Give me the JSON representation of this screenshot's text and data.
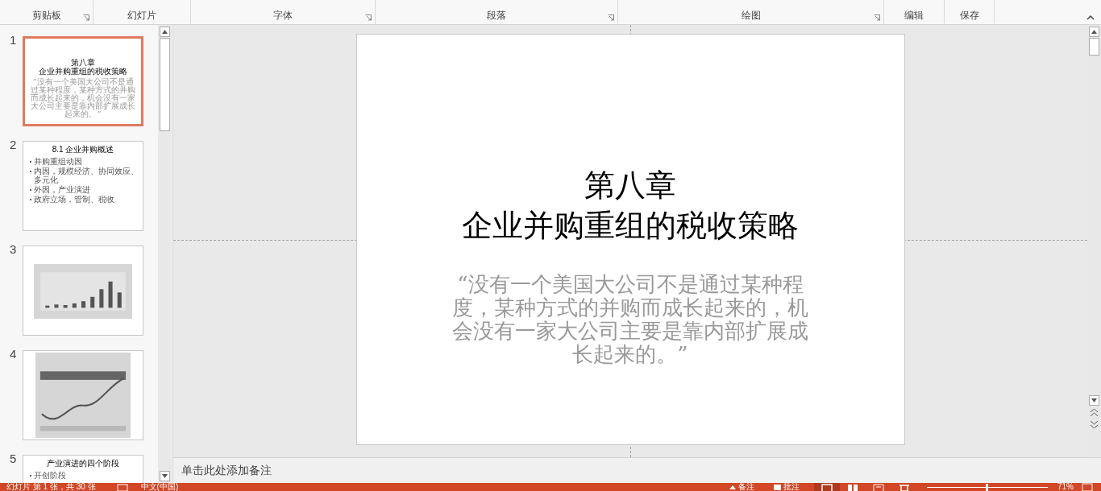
{
  "ribbon": {
    "groups": [
      {
        "label": "剪贴板",
        "launcher": true
      },
      {
        "label": "幻灯片",
        "launcher": false
      },
      {
        "label": "字体",
        "launcher": true
      },
      {
        "label": "段落",
        "launcher": true
      },
      {
        "label": "绘图",
        "launcher": true
      },
      {
        "label": "编辑",
        "launcher": false
      },
      {
        "label": "保存",
        "launcher": false
      }
    ]
  },
  "slides": [
    {
      "number": "1",
      "selected": true,
      "kind": "title",
      "title": [
        "第八章",
        "企业并购重组的税收策略"
      ],
      "quote": "“没有一个美国大公司不是通过某种程度，某种方式的并购而成长起来的，机会没有一家大公司主要是靠内部扩展成长起来的。”"
    },
    {
      "number": "2",
      "selected": false,
      "kind": "bullets",
      "title": "8.1 企业并购概述",
      "bullets": [
        "并购重组动因",
        "内因，规模经济、协同效应、多元化",
        "外因，产业演进",
        "政府立场，管制、税收"
      ]
    },
    {
      "number": "3",
      "selected": false,
      "kind": "picture"
    },
    {
      "number": "4",
      "selected": false,
      "kind": "picture"
    },
    {
      "number": "5",
      "selected": false,
      "kind": "bullets",
      "title": "产业演进的四个阶段",
      "bullets": [
        "开创阶段"
      ]
    }
  ],
  "editor": {
    "title": [
      "第八章",
      "企业并购重组的税收策略"
    ],
    "quote": "“没有一个美国大公司不是通过某种程度，某种方式的并购而成长起来的，机会没有一家大公司主要是靠内部扩展成长起来的。”"
  },
  "notes": {
    "placeholder": "单击此处添加备注"
  },
  "status_bar": {
    "slide_info": "幻灯片 第 1 张，共 30 张",
    "language": "中文(中国)",
    "notes_button": "备注",
    "comments_button": "批注",
    "views": [
      {
        "kind": "normal",
        "selected": true
      },
      {
        "kind": "sorter",
        "selected": false
      },
      {
        "kind": "reading",
        "selected": false
      },
      {
        "kind": "show",
        "selected": false
      }
    ],
    "zoom": {
      "level": 0.5,
      "reading": "71%"
    }
  }
}
